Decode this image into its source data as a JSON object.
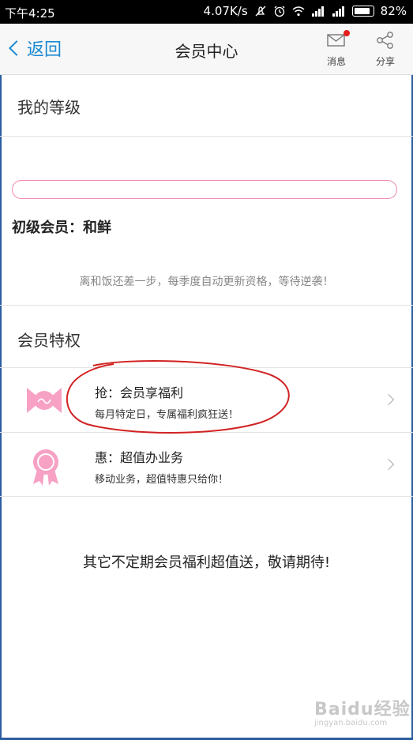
{
  "status_bar": {
    "time": "下午4:25",
    "speed": "4.07K/s",
    "battery": "82%",
    "icons": [
      "mute-icon",
      "alarm-icon",
      "wifi-icon",
      "signal-icon",
      "signal-icon",
      "battery-icon"
    ]
  },
  "header": {
    "back_label": "返回",
    "title": "会员中心",
    "messages_label": "消息",
    "share_label": "分享",
    "accent_color": "#1a8ad3",
    "notification_dot_color": "#e61d1d"
  },
  "my_level": {
    "heading": "我的等级",
    "progress_fraction": 0.0,
    "progress_border_color": "#f08ab5",
    "level_text": "初级会员：和鲜",
    "tip": "离和饭还差一步，每季度自动更新资格，等待逆袭！"
  },
  "privileges": {
    "heading": "会员特权",
    "items": [
      {
        "icon": "candy-icon",
        "title": "抢：会员享福利",
        "subtitle": "每月特定日，专属福利疯狂送！"
      },
      {
        "icon": "ribbon-badge-icon",
        "title": "惠：超值办业务",
        "subtitle": "移动业务，超值特惠只给你！"
      }
    ],
    "icon_color": "#f7a1c4",
    "annotation_color": "#d22222"
  },
  "footer_text": "其它不定期会员福利超值送，敬请期待!",
  "watermark": {
    "brand": "Baidu经验",
    "url": "jingyan.baidu.com"
  }
}
